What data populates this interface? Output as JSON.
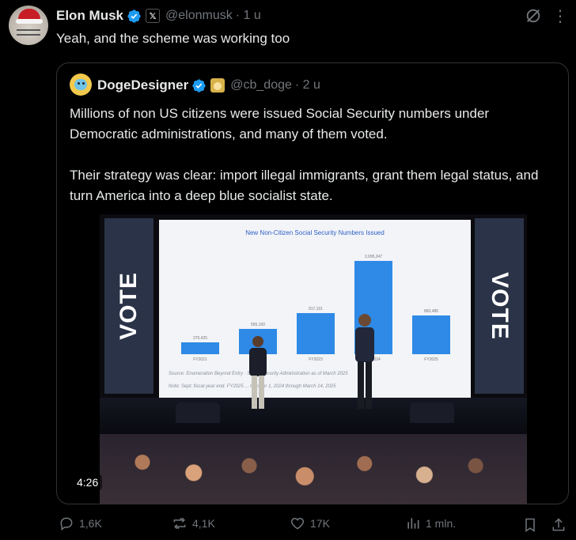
{
  "author": {
    "name": "Elon Musk",
    "affiliate_badge": "𝕏",
    "handle": "@elonmusk",
    "time": "· 1 u"
  },
  "tweet": {
    "text": "Yeah, and the scheme was working too"
  },
  "quote": {
    "name": "DogeDesigner",
    "handle": "@cb_doge",
    "time": "· 2 u",
    "paragraph1": "Millions of non US citizens were issued Social Security numbers under Democratic administrations, and many of them voted.",
    "paragraph2": "Their strategy was clear: import illegal immigrants, grant them legal status, and turn America into a deep blue socialist state.",
    "video": {
      "duration": "4:26",
      "banner_left": "VOTE",
      "banner_right": "VOTE",
      "chart_data": {
        "type": "bar",
        "title": "New Non-Citizen Social Security Numbers Issued",
        "categories": [
          "FY2021",
          "FY2022",
          "FY2023",
          "FY2024",
          "FY2025"
        ],
        "values": [
          270425,
          565100,
          917101,
          2095247,
          860480
        ],
        "value_labels": [
          "270,425",
          "565,100",
          "917,101",
          "2,095,247",
          "860,480"
        ],
        "ylim": [
          0,
          2300000
        ],
        "grid": false,
        "source": "Source: Enumeration Beyond Entry · Social Security Administration as of March 2025",
        "note": "Note: Sept: fiscal year end. FY2025 ... October 1, 2024 through March 14, 2025"
      }
    }
  },
  "actions": {
    "replies": "1,6K",
    "reposts": "4,1K",
    "likes": "17K",
    "views": "1 mln."
  },
  "colors": {
    "verified": "#1d9bf0",
    "muted": "#71767b",
    "text": "#e7e9ea",
    "border": "#2f3336",
    "bar": "#2e8ae6"
  }
}
